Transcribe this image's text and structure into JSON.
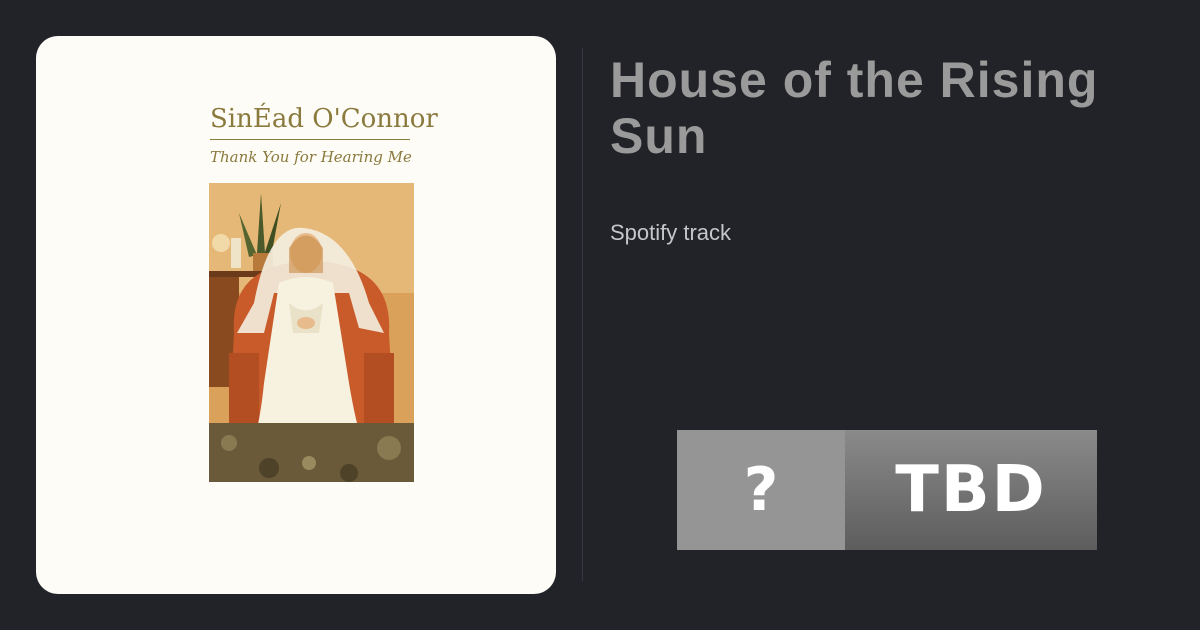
{
  "track": {
    "title_line1": "House of the Rising",
    "title_line2": "Sun",
    "source": "Spotify track"
  },
  "cover": {
    "artist": "SinÉad O'Connor",
    "album": "Thank You for Hearing Me"
  },
  "badge": {
    "left": "?",
    "right": "TBD"
  },
  "colors": {
    "background": "#212328",
    "title": "#9a9a9a",
    "cover_text": "#8b7a3e"
  }
}
